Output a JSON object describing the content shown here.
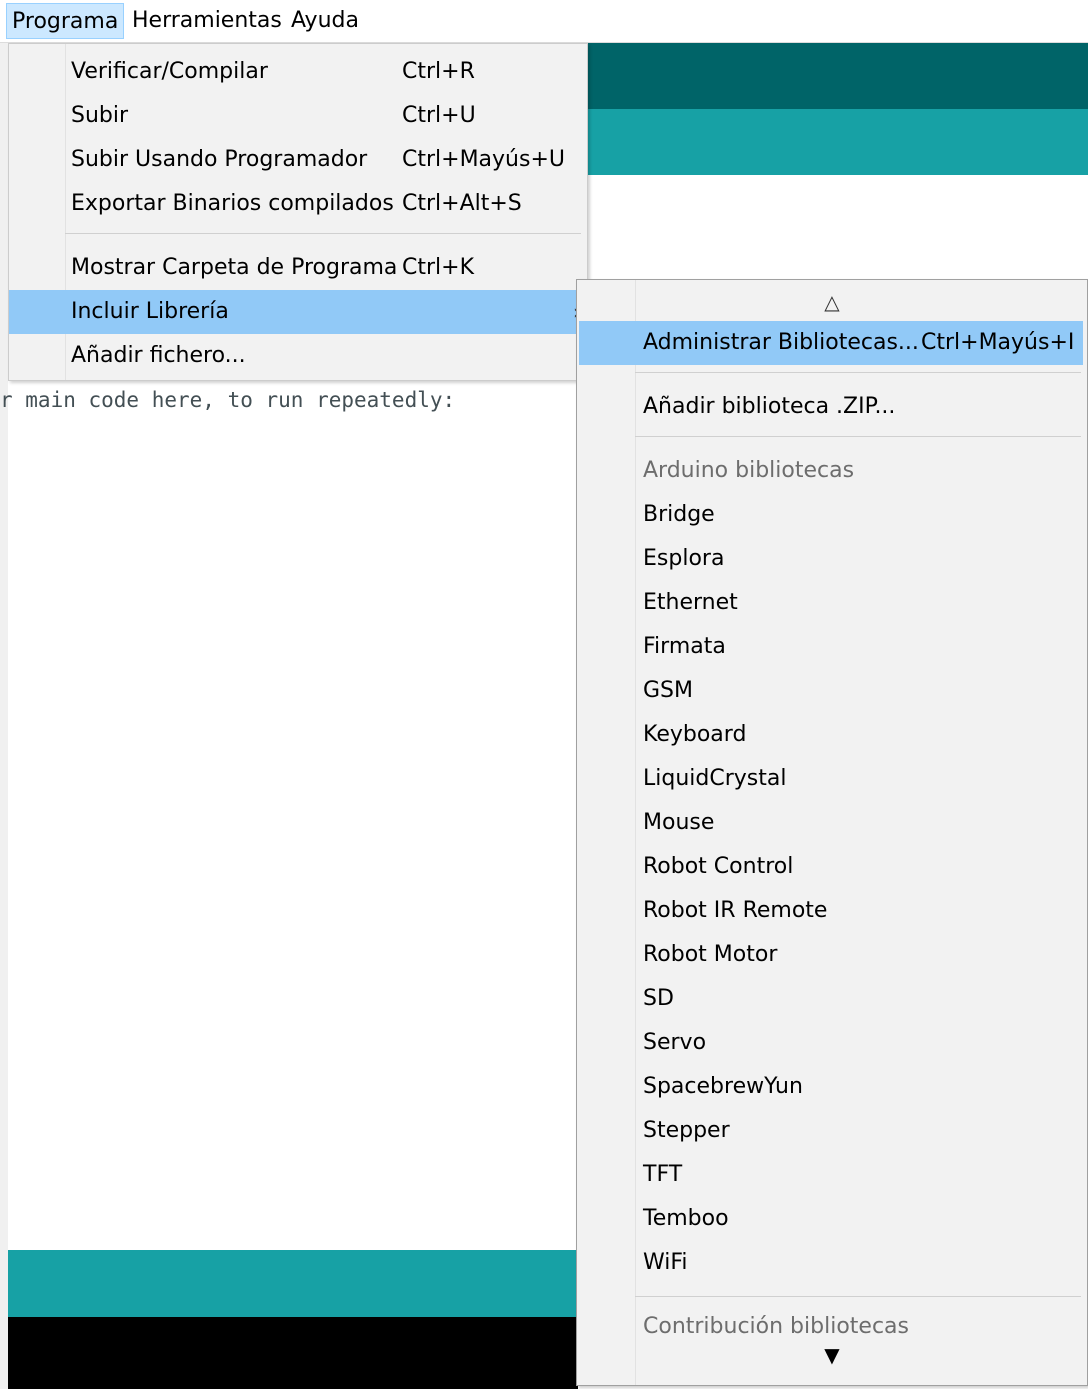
{
  "menubar": {
    "items": [
      "Programa",
      "Herramientas",
      "Ayuda"
    ]
  },
  "editor": {
    "code_fragment": "r main code here, to run repeatedly:"
  },
  "programa_menu": {
    "items": [
      {
        "label": "Verificar/Compilar",
        "shortcut": "Ctrl+R"
      },
      {
        "label": "Subir",
        "shortcut": "Ctrl+U"
      },
      {
        "label": "Subir Usando Programador",
        "shortcut": "Ctrl+Mayús+U"
      },
      {
        "label": "Exportar Binarios compilados",
        "shortcut": "Ctrl+Alt+S"
      },
      {
        "label": "Mostrar Carpeta de Programa",
        "shortcut": "Ctrl+K"
      },
      {
        "label": "Incluir Librería",
        "shortcut": ""
      },
      {
        "label": "Añadir fichero...",
        "shortcut": ""
      }
    ],
    "submenu_arrow": "›"
  },
  "library_submenu": {
    "scroll_up": "△",
    "manage": {
      "label": "Administrar Bibliotecas...",
      "shortcut": "Ctrl+Mayús+I"
    },
    "add_zip": "Añadir biblioteca .ZIP...",
    "arduino_header": "Arduino bibliotecas",
    "libraries": [
      "Bridge",
      "Esplora",
      "Ethernet",
      "Firmata",
      "GSM",
      "Keyboard",
      "LiquidCrystal",
      "Mouse",
      "Robot Control",
      "Robot IR Remote",
      "Robot Motor",
      "SD",
      "Servo",
      "SpacebrewYun",
      "Stepper",
      "TFT",
      "Temboo",
      "WiFi"
    ],
    "contrib_header": "Contribución bibliotecas",
    "scroll_down": "▼"
  }
}
